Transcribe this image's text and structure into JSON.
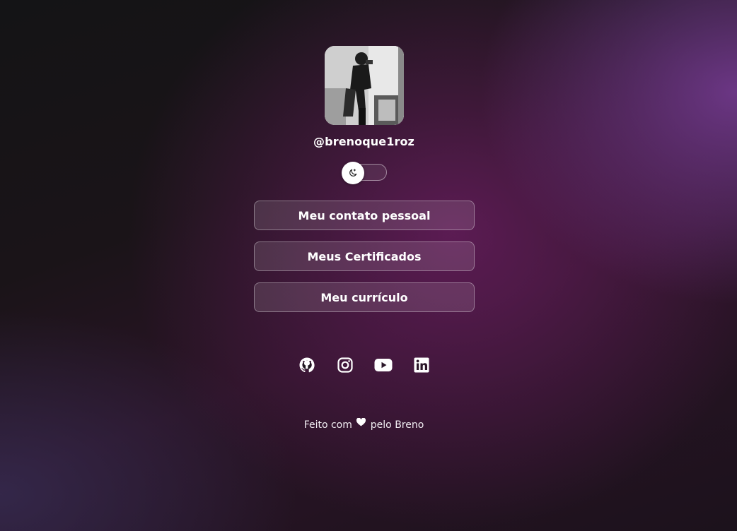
{
  "profile": {
    "username": "@brenoque1roz"
  },
  "theme_toggle": {
    "icon": "moon-icon"
  },
  "links": [
    {
      "label": "Meu contato pessoal"
    },
    {
      "label": "Meus Certificados"
    },
    {
      "label": "Meu currículo"
    }
  ],
  "socials": [
    {
      "icon": "github-icon"
    },
    {
      "icon": "instagram-icon"
    },
    {
      "icon": "youtube-icon"
    },
    {
      "icon": "linkedin-icon"
    }
  ],
  "footer": {
    "prefix": "Feito com",
    "icon": "heart-icon",
    "suffix": "pelo Breno"
  },
  "colors": {
    "background_accent": "#6a2c7a",
    "button_border": "#ffffff",
    "text": "#ffffff"
  }
}
